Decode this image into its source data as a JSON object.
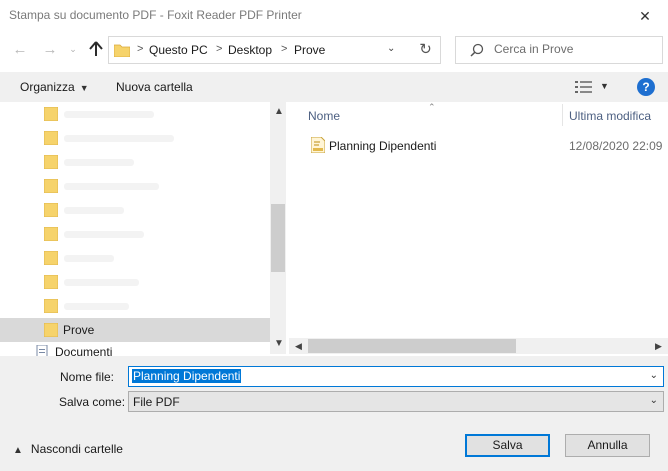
{
  "window": {
    "title": "Stampa su documento PDF - Foxit Reader PDF Printer",
    "close_glyph": "✕"
  },
  "nav": {
    "back_glyph": "←",
    "forward_glyph": "→",
    "up_icon": "up-arrow-icon",
    "breadcrumbs": [
      "Questo PC",
      "Desktop",
      "Prove"
    ],
    "separator": ">",
    "refresh_glyph": "↻",
    "search_placeholder": "Cerca in Prove"
  },
  "toolbar": {
    "organize_label": "Organizza",
    "new_folder_label": "Nuova cartella",
    "help_label": "?"
  },
  "tree": {
    "selected_folder": "Prove",
    "documents_label": "Documenti"
  },
  "file_list": {
    "col_name": "Nome",
    "col_date": "Ultima modifica",
    "files": [
      {
        "name": "Planning Dipendenti",
        "modified": "12/08/2020 22:09",
        "icon": "foxit-pdf-icon"
      }
    ]
  },
  "form": {
    "filename_label": "Nome file:",
    "filename_value": "Planning Dipendenti",
    "savetype_label": "Salva come:",
    "savetype_value": "File PDF",
    "hide_folders_label": "Nascondi cartelle",
    "save_button": "Salva",
    "cancel_button": "Annulla"
  },
  "colors": {
    "accent": "#0078d7",
    "help": "#1e6fd0",
    "folder": "#f6d36b"
  }
}
